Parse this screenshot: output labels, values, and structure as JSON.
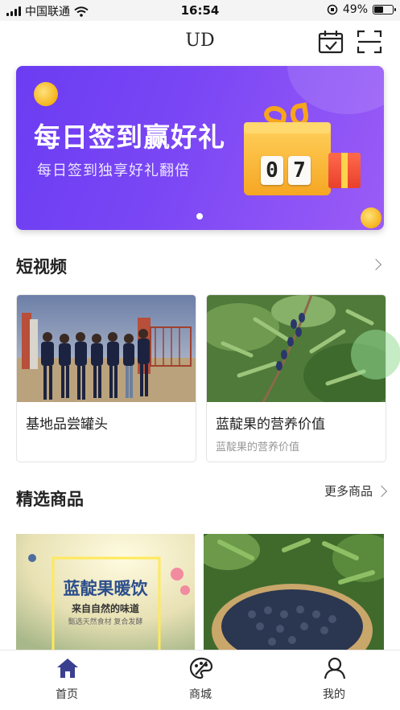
{
  "status_bar": {
    "carrier": "中国联通",
    "time": "16:54",
    "battery": "49%",
    "battery_level": 0.49
  },
  "nav": {
    "title": "UD",
    "icons": [
      "calendar-check-icon",
      "scan-icon"
    ]
  },
  "banner": {
    "title": "每日签到赢好礼",
    "subtitle": "每日签到独享好礼翻倍",
    "counter_digits": [
      "0",
      "7"
    ],
    "page_count": 1
  },
  "videos": {
    "title": "短视频",
    "items": [
      {
        "title": "基地品尝罐头",
        "subtitle": ""
      },
      {
        "title": "蓝靛果的营养价值",
        "subtitle": "蓝靛果的营养价值"
      }
    ]
  },
  "products": {
    "title": "精选商品",
    "more_label": "更多商品",
    "items": [
      {
        "poster_title": "蓝靛果暖饮",
        "poster_subtitle": "来自自然的味道",
        "poster_tagline": "甄选天然食材 复合发酵"
      },
      {
        "image": "honeysuckle-berries-basket"
      }
    ]
  },
  "tab_bar": {
    "items": [
      {
        "label": "首页",
        "icon": "home-icon",
        "active": true
      },
      {
        "label": "商城",
        "icon": "palette-icon",
        "active": false
      },
      {
        "label": "我的",
        "icon": "user-icon",
        "active": false
      }
    ],
    "active_color": "#3b3f8f"
  },
  "colors": {
    "banner_start": "#6b3cf2",
    "banner_end": "#9b5cf6",
    "accent": "#3b3f8f"
  }
}
